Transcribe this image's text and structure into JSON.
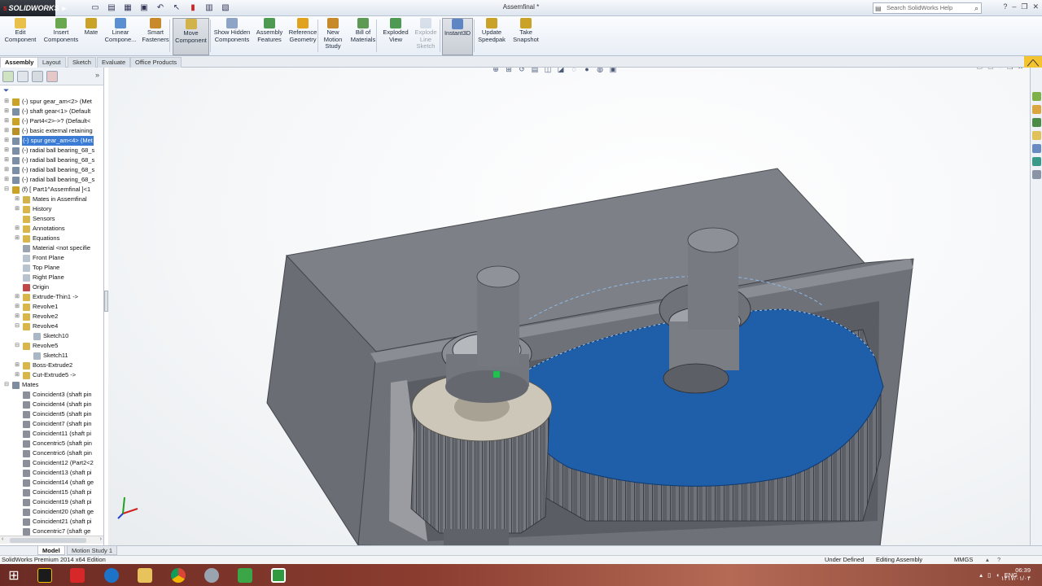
{
  "app": {
    "logo_text": "SOLIDWORKS",
    "document_title": "Assemfinal *",
    "help_search_placeholder": "Search SolidWorks Help"
  },
  "ribbon": {
    "buttons": [
      {
        "label": "Edit Component",
        "icon": "edit-component-icon"
      },
      {
        "label": "Insert Components",
        "icon": "insert-components-icon"
      },
      {
        "label": "Mate",
        "icon": "mate-icon"
      },
      {
        "label": "Linear Compone...",
        "icon": "linear-pattern-icon"
      },
      {
        "label": "Smart Fasteners",
        "icon": "smart-fasteners-icon"
      },
      {
        "label": "Move Component",
        "icon": "move-component-icon",
        "active": true
      },
      {
        "label": "Show Hidden Components",
        "icon": "show-hidden-icon"
      },
      {
        "label": "Assembly Features",
        "icon": "assembly-features-icon"
      },
      {
        "label": "Reference Geometry",
        "icon": "reference-geometry-icon"
      },
      {
        "label": "New Motion Study",
        "icon": "motion-study-icon"
      },
      {
        "label": "Bill of Materials",
        "icon": "bom-icon"
      },
      {
        "label": "Exploded View",
        "icon": "exploded-view-icon"
      },
      {
        "label": "Explode Line Sketch",
        "icon": "explode-line-icon",
        "disabled": true
      },
      {
        "label": "Instant3D",
        "icon": "instant3d-icon",
        "active": true
      },
      {
        "label": "Update Speedpak",
        "icon": "speedpak-icon"
      },
      {
        "label": "Take Snapshot",
        "icon": "snapshot-icon"
      }
    ]
  },
  "command_tabs": [
    "Assembly",
    "Layout",
    "Sketch",
    "Evaluate",
    "Office Products"
  ],
  "tree": {
    "rows": [
      {
        "label": "(-) spur gear_am<2> (Met",
        "indent": 0,
        "exp": "+"
      },
      {
        "label": "(-) shaft gear<1> (Default",
        "indent": 0,
        "exp": "+"
      },
      {
        "label": "(-) Part4<2>->? (Default<",
        "indent": 0,
        "exp": "+"
      },
      {
        "label": "(-) basic external retaining",
        "indent": 0,
        "exp": "+"
      },
      {
        "label": "(-) spur gear_am<4> (Met",
        "indent": 0,
        "exp": "+",
        "selected": true
      },
      {
        "label": "(-) radial ball bearing_68_s",
        "indent": 0,
        "exp": "+"
      },
      {
        "label": "(-) radial ball bearing_68_s",
        "indent": 0,
        "exp": "+"
      },
      {
        "label": "(-) radial ball bearing_68_s",
        "indent": 0,
        "exp": "+"
      },
      {
        "label": "(-) radial ball bearing_68_s",
        "indent": 0,
        "exp": "+"
      },
      {
        "label": "(f) [ Part1^Assemfinal ]<1",
        "indent": 0,
        "exp": "-"
      },
      {
        "label": "Mates in Assemfinal",
        "indent": 1,
        "exp": "+"
      },
      {
        "label": "History",
        "indent": 1,
        "exp": "+"
      },
      {
        "label": "Sensors",
        "indent": 1,
        "exp": ""
      },
      {
        "label": "Annotations",
        "indent": 1,
        "exp": "+"
      },
      {
        "label": "Equations",
        "indent": 1,
        "exp": "+"
      },
      {
        "label": "Material <not specifie",
        "indent": 1,
        "exp": ""
      },
      {
        "label": "Front Plane",
        "indent": 1,
        "exp": ""
      },
      {
        "label": "Top Plane",
        "indent": 1,
        "exp": ""
      },
      {
        "label": "Right Plane",
        "indent": 1,
        "exp": ""
      },
      {
        "label": "Origin",
        "indent": 1,
        "exp": ""
      },
      {
        "label": "Extrude-Thin1 ->",
        "indent": 1,
        "exp": "+"
      },
      {
        "label": "Revolve1",
        "indent": 1,
        "exp": "+"
      },
      {
        "label": "Revolve2",
        "indent": 1,
        "exp": "+"
      },
      {
        "label": "Revolve4",
        "indent": 1,
        "exp": "-"
      },
      {
        "label": "Sketch10",
        "indent": 2,
        "exp": ""
      },
      {
        "label": "Revolve5",
        "indent": 1,
        "exp": "-"
      },
      {
        "label": "Sketch11",
        "indent": 2,
        "exp": ""
      },
      {
        "label": "Boss-Extrude2",
        "indent": 1,
        "exp": "+"
      },
      {
        "label": "Cut-Extrude5 ->",
        "indent": 1,
        "exp": "+"
      },
      {
        "label": "Mates",
        "indent": 0,
        "exp": "-"
      },
      {
        "label": "Coincident3 (shaft pin",
        "indent": 1,
        "exp": ""
      },
      {
        "label": "Coincident4 (shaft pin",
        "indent": 1,
        "exp": ""
      },
      {
        "label": "Coincident5 (shaft pin",
        "indent": 1,
        "exp": ""
      },
      {
        "label": "Coincident7 (shaft pin",
        "indent": 1,
        "exp": ""
      },
      {
        "label": "Coincident11 (shaft pi",
        "indent": 1,
        "exp": ""
      },
      {
        "label": "Concentric5 (shaft pin",
        "indent": 1,
        "exp": ""
      },
      {
        "label": "Concentric6 (shaft pin",
        "indent": 1,
        "exp": ""
      },
      {
        "label": "Coincident12 (Part2<2",
        "indent": 1,
        "exp": ""
      },
      {
        "label": "Coincident13 (shaft pi",
        "indent": 1,
        "exp": ""
      },
      {
        "label": "Coincident14 (shaft ge",
        "indent": 1,
        "exp": ""
      },
      {
        "label": "Coincident15 (shaft pi",
        "indent": 1,
        "exp": ""
      },
      {
        "label": "Coincident19 (shaft pi",
        "indent": 1,
        "exp": ""
      },
      {
        "label": "Coincident20 (shaft ge",
        "indent": 1,
        "exp": ""
      },
      {
        "label": "Coincident21 (shaft pi",
        "indent": 1,
        "exp": ""
      },
      {
        "label": "Concentric7 (shaft ge",
        "indent": 1,
        "exp": ""
      }
    ]
  },
  "model_tabs": [
    "Model",
    "Motion Study 1"
  ],
  "status": {
    "edition": "SolidWorks Premium 2014 x64 Edition",
    "definition": "Under Defined",
    "mode": "Editing Assembly",
    "units": "MMGS"
  },
  "taskbar": {
    "language": "ENG",
    "time": "06:39",
    "date": "۱۴۱۷/۰۱/۰۴"
  },
  "colors": {
    "selected_gear": "#1f5ea8",
    "housing": "#6b6e76",
    "small_gear": "#c9c3b6"
  }
}
